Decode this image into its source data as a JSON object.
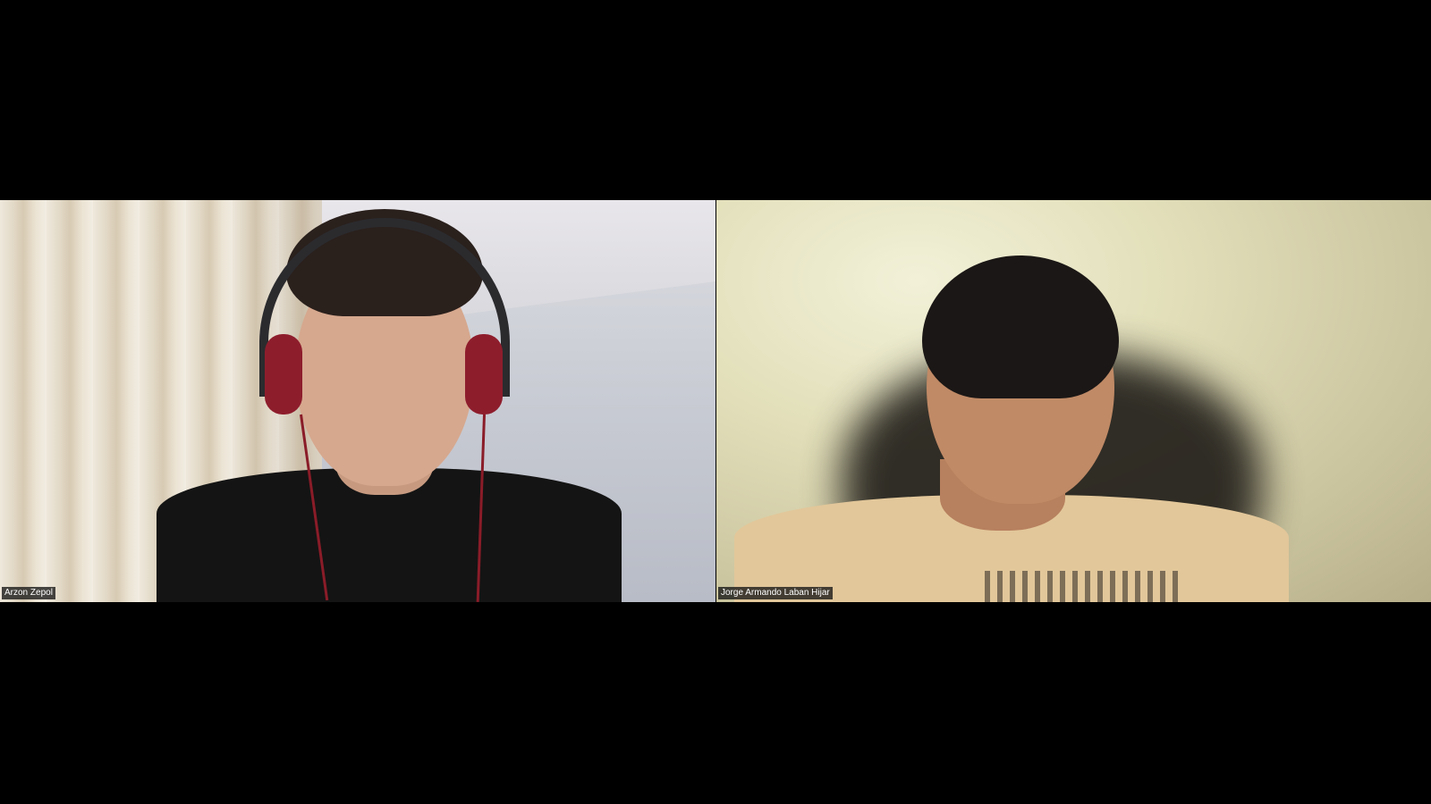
{
  "meeting": {
    "layout": "gallery-view",
    "participants": [
      {
        "name": "Arzon Zepol",
        "accent_colors": {
          "background": "#d9d9de",
          "shirt": "#141414",
          "headphones": "#8e1d2c"
        }
      },
      {
        "name": "Jorge Armando Laban Hijar",
        "accent_colors": {
          "background": "#e2dfba",
          "shirt": "#e2c79a"
        }
      }
    ]
  }
}
